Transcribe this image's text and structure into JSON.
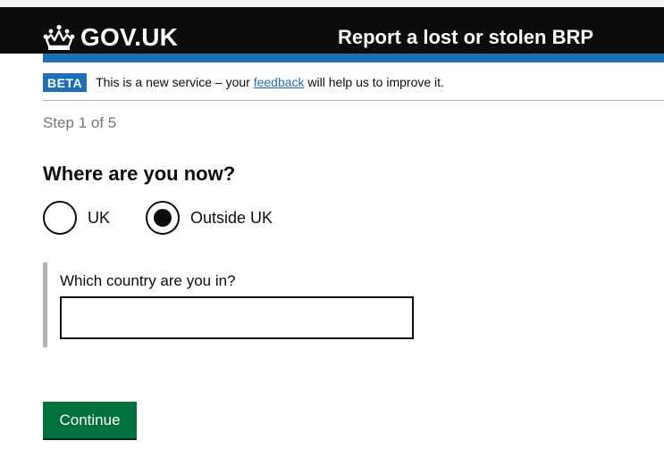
{
  "header": {
    "logo_text": "GOV.UK",
    "logo_icon": "crown-icon",
    "service_name": "Report a lost or stolen BRP"
  },
  "phase_banner": {
    "tag": "BETA",
    "text_before": "This is a new service – your ",
    "link": "feedback",
    "text_after": " will help us to improve it."
  },
  "step": "Step 1 of 5",
  "question": {
    "legend": "Where are you now?",
    "options": [
      {
        "label": "UK",
        "selected": false
      },
      {
        "label": "Outside UK",
        "selected": true
      }
    ]
  },
  "conditional": {
    "label": "Which country are you in?",
    "value": ""
  },
  "continue_label": "Continue",
  "colors": {
    "header": "#0b0c0c",
    "brand_blue": "#1d70b8",
    "button_green": "#00703c",
    "secondary_text": "#6f777b",
    "border_grey": "#b1b4b6"
  }
}
